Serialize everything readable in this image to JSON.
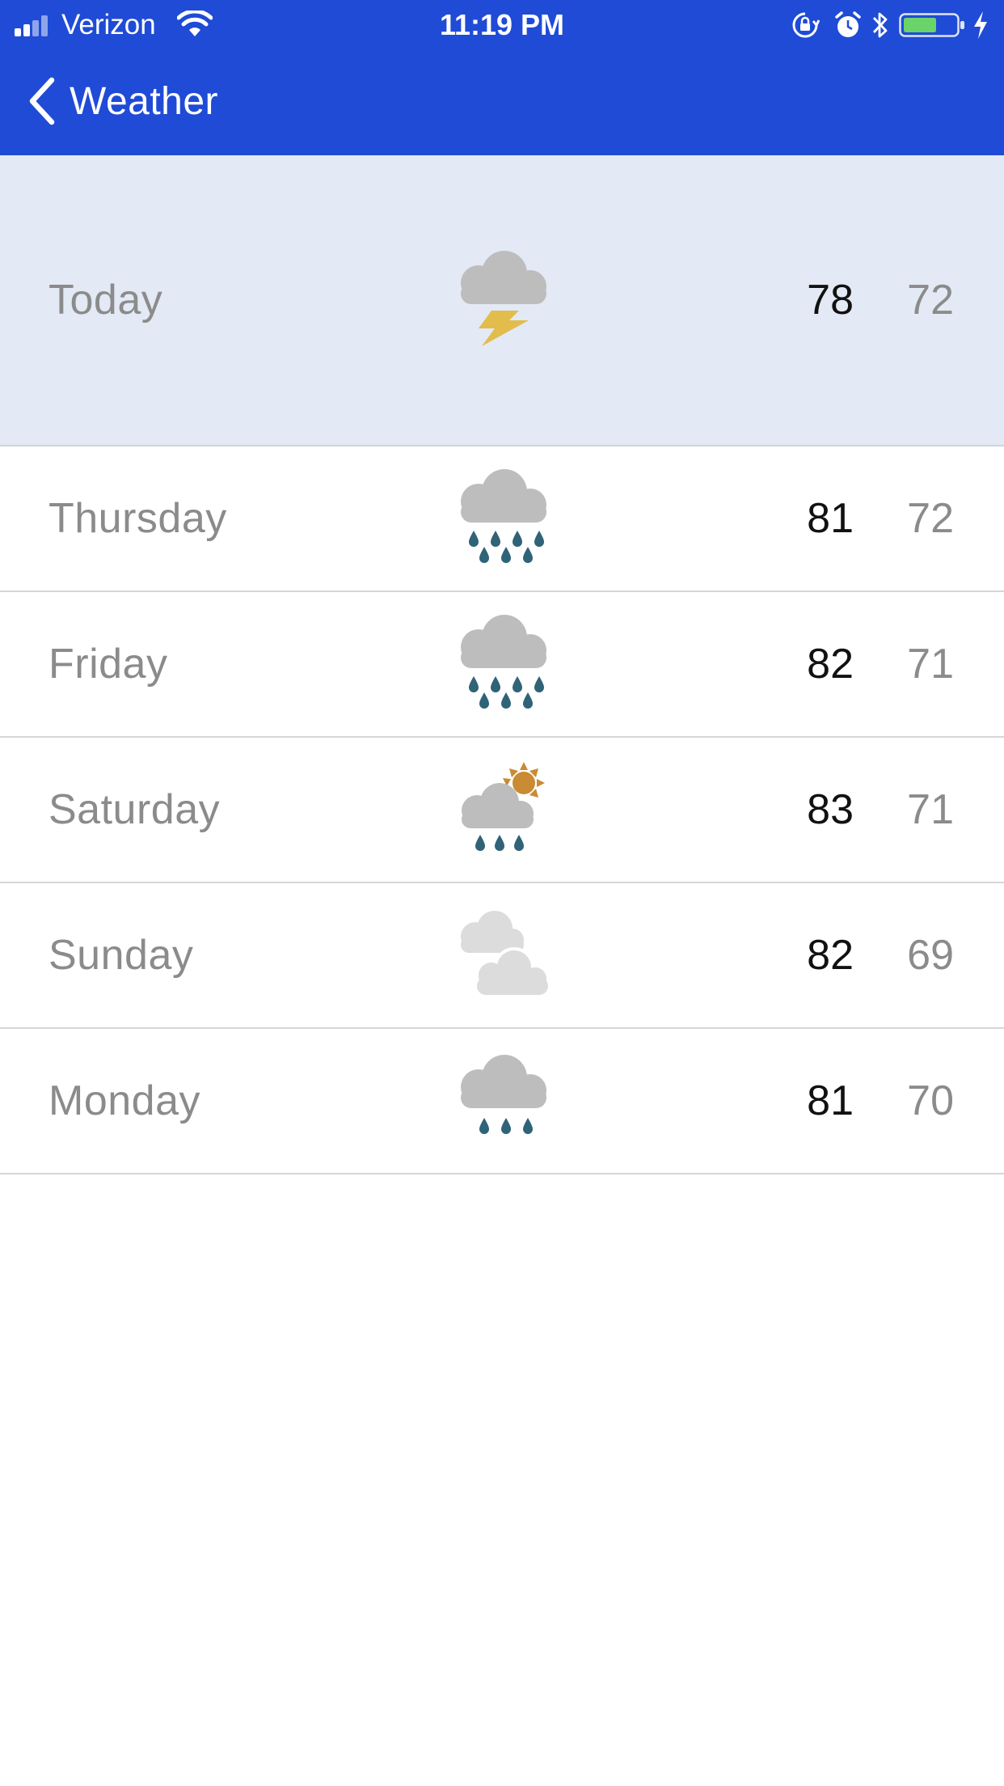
{
  "status_bar": {
    "carrier": "Verizon",
    "time": "11:19 PM",
    "battery_percent": 65
  },
  "nav": {
    "back_label": "Weather"
  },
  "colors": {
    "header_bg": "#1f4bd6",
    "today_bg": "#e3e9f5",
    "cloud": "#bdbdbd",
    "light_cloud": "#dcdcdc",
    "rain": "#2f6378",
    "lightning": "#e2bd4c",
    "sun": "#c98b33",
    "battery_fill": "#6ad36a"
  },
  "forecast": [
    {
      "day": "Today",
      "icon": "thunderstorm-icon",
      "high": "78",
      "low": "72"
    },
    {
      "day": "Thursday",
      "icon": "heavy-rain-icon",
      "high": "81",
      "low": "72"
    },
    {
      "day": "Friday",
      "icon": "heavy-rain-icon",
      "high": "82",
      "low": "71"
    },
    {
      "day": "Saturday",
      "icon": "sun-showers-icon",
      "high": "83",
      "low": "71"
    },
    {
      "day": "Sunday",
      "icon": "cloudy-icon",
      "high": "82",
      "low": "69"
    },
    {
      "day": "Monday",
      "icon": "light-rain-icon",
      "high": "81",
      "low": "70"
    }
  ]
}
